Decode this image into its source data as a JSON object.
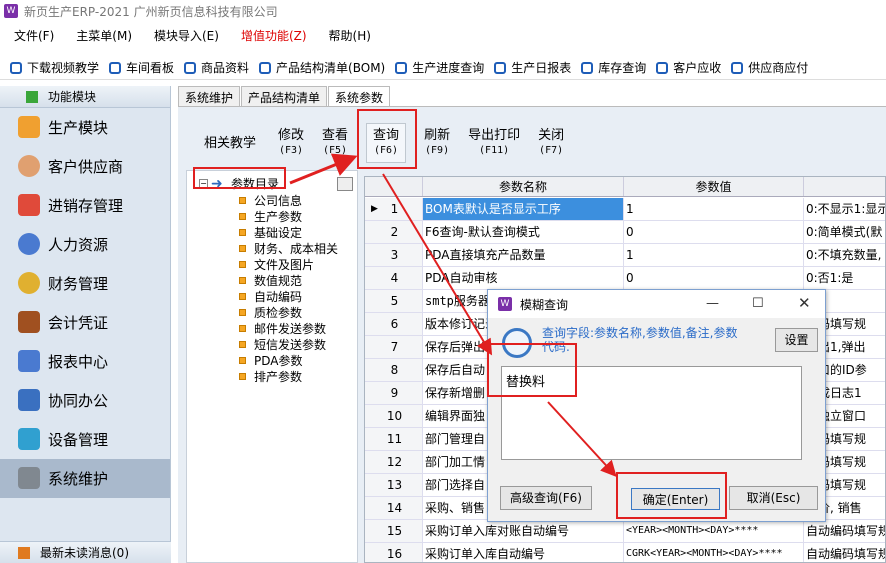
{
  "app": {
    "title": "新页生产ERP-2021 广州新页信息科技有限公司",
    "logo_text": "W"
  },
  "menu": [
    "文件(F)",
    "主菜单(M)",
    "模块导入(E)",
    "增值功能(Z)",
    "帮助(H)"
  ],
  "toolbar": [
    "下载视频教学",
    "车间看板",
    "商品资料",
    "产品结构清单(BOM)",
    "生产进度查询",
    "生产日报表",
    "库存查询",
    "客户应收",
    "供应商应付"
  ],
  "sidebar": {
    "header": "功能模块",
    "items": [
      {
        "label": "生产模块",
        "color": "#f0a030"
      },
      {
        "label": "客户供应商",
        "color": "#e0a070"
      },
      {
        "label": "进销存管理",
        "color": "#e04a3a"
      },
      {
        "label": "人力资源",
        "color": "#4a7ad0"
      },
      {
        "label": "财务管理",
        "color": "#e0b030"
      },
      {
        "label": "会计凭证",
        "color": "#a05020"
      },
      {
        "label": "报表中心",
        "color": "#4a7ad0"
      },
      {
        "label": "协同办公",
        "color": "#3a70c0"
      },
      {
        "label": "设备管理",
        "color": "#30a0d0"
      },
      {
        "label": "系统维护",
        "color": "#808890"
      }
    ],
    "footer": "最新未读消息(0)"
  },
  "tabs": [
    "系统维护",
    "产品结构清单",
    "系统参数"
  ],
  "funcbar": [
    {
      "label": "相关教学",
      "key": ""
    },
    {
      "label": "修改",
      "key": "(F3)"
    },
    {
      "label": "查看",
      "key": "(F5)"
    },
    {
      "label": "查询",
      "key": "(F6)"
    },
    {
      "label": "刷新",
      "key": "(F9)"
    },
    {
      "label": "导出打印",
      "key": "(F11)"
    },
    {
      "label": "关闭",
      "key": "(F7)"
    }
  ],
  "tree": {
    "root": "参数目录",
    "nodes": [
      "公司信息",
      "生产参数",
      "基础设定",
      "财务、成本相关",
      "文件及图片",
      "数值规范",
      "自动编码",
      "质检参数",
      "邮件发送参数",
      "短信发送参数",
      "PDA参数",
      "排产参数"
    ]
  },
  "grid": {
    "headers": [
      "",
      "参数名称",
      "参数值",
      ""
    ],
    "rows": [
      {
        "n": "1",
        "name": "BOM表默认是否显示工序",
        "value": "1",
        "note": "0:不显示1:显示"
      },
      {
        "n": "2",
        "name": "F6查询-默认查询模式",
        "value": "0",
        "note": "0:简单模式(默"
      },
      {
        "n": "3",
        "name": "PDA直接填充产品数量",
        "value": "1",
        "note": "0:不填充数量,"
      },
      {
        "n": "4",
        "name": "PDA自动审核",
        "value": "0",
        "note": "0:否1:是"
      },
      {
        "n": "5",
        "name": "smtp服务器",
        "value": "",
        "note": ""
      },
      {
        "n": "6",
        "name": "版本修订记录",
        "value": "",
        "note": "编码填写规"
      },
      {
        "n": "7",
        "name": "保存后弹出",
        "value": "",
        "note": "弹出1,弹出"
      },
      {
        "n": "8",
        "name": "保存后自动",
        "value": "",
        "note": "窗口的ID参"
      },
      {
        "n": "9",
        "name": "保存新增删",
        "value": "",
        "note": "生成日志1"
      },
      {
        "n": "10",
        "name": "编辑界面独",
        "value": "",
        "note": "示独立窗口"
      },
      {
        "n": "11",
        "name": "部门管理自",
        "value": "",
        "note": "编码填写规"
      },
      {
        "n": "12",
        "name": "部门加工情",
        "value": "",
        "note": "编码填写规"
      },
      {
        "n": "13",
        "name": "部门选择自",
        "value": "",
        "note": "编码填写规"
      },
      {
        "n": "14",
        "name": "采购、销售",
        "value": "",
        "note": "单价, 销售"
      },
      {
        "n": "15",
        "name": "采购订单入库对账自动编号",
        "value": "<YEAR><MONTH><DAY>****",
        "note": "自动编码填写规"
      },
      {
        "n": "16",
        "name": "采购订单入库自动编号",
        "value": "CGRK<YEAR><MONTH><DAY>****",
        "note": "自动编码填写规"
      }
    ]
  },
  "dialog": {
    "title": "模糊查询",
    "hint": "查询字段:参数名称,参数值,备注,参数代码.",
    "settings": "设置",
    "input_value": "替换料",
    "advanced": "高级查询(F6)",
    "ok": "确定(Enter)",
    "cancel": "取消(Esc)"
  }
}
